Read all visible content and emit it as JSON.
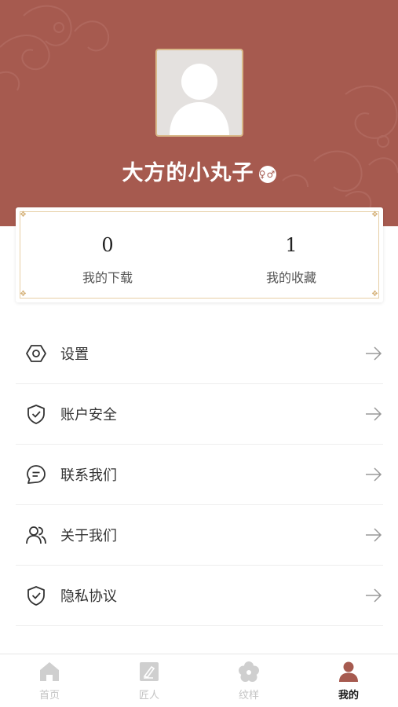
{
  "profile": {
    "username": "大方的小丸子",
    "gender_badge": "♀♂"
  },
  "stats": [
    {
      "value": "0",
      "label": "我的下载"
    },
    {
      "value": "1",
      "label": "我的收藏"
    }
  ],
  "menu": [
    {
      "label": "设置",
      "icon": "hexagon-settings-icon"
    },
    {
      "label": "账户安全",
      "icon": "shield-check-icon"
    },
    {
      "label": "联系我们",
      "icon": "chat-bubble-icon"
    },
    {
      "label": "关于我们",
      "icon": "users-icon"
    },
    {
      "label": "隐私协议",
      "icon": "shield-check-icon"
    }
  ],
  "tabbar": [
    {
      "label": "首页",
      "icon": "home-icon",
      "active": false
    },
    {
      "label": "匠人",
      "icon": "craftsman-icon",
      "active": false
    },
    {
      "label": "纹样",
      "icon": "flower-icon",
      "active": false
    },
    {
      "label": "我的",
      "icon": "person-icon",
      "active": true
    }
  ],
  "colors": {
    "brand": "#a65a4f",
    "card_border": "#e7cfa5",
    "tab_inactive": "#c4c4c4",
    "tab_active": "#1a1a1a"
  }
}
